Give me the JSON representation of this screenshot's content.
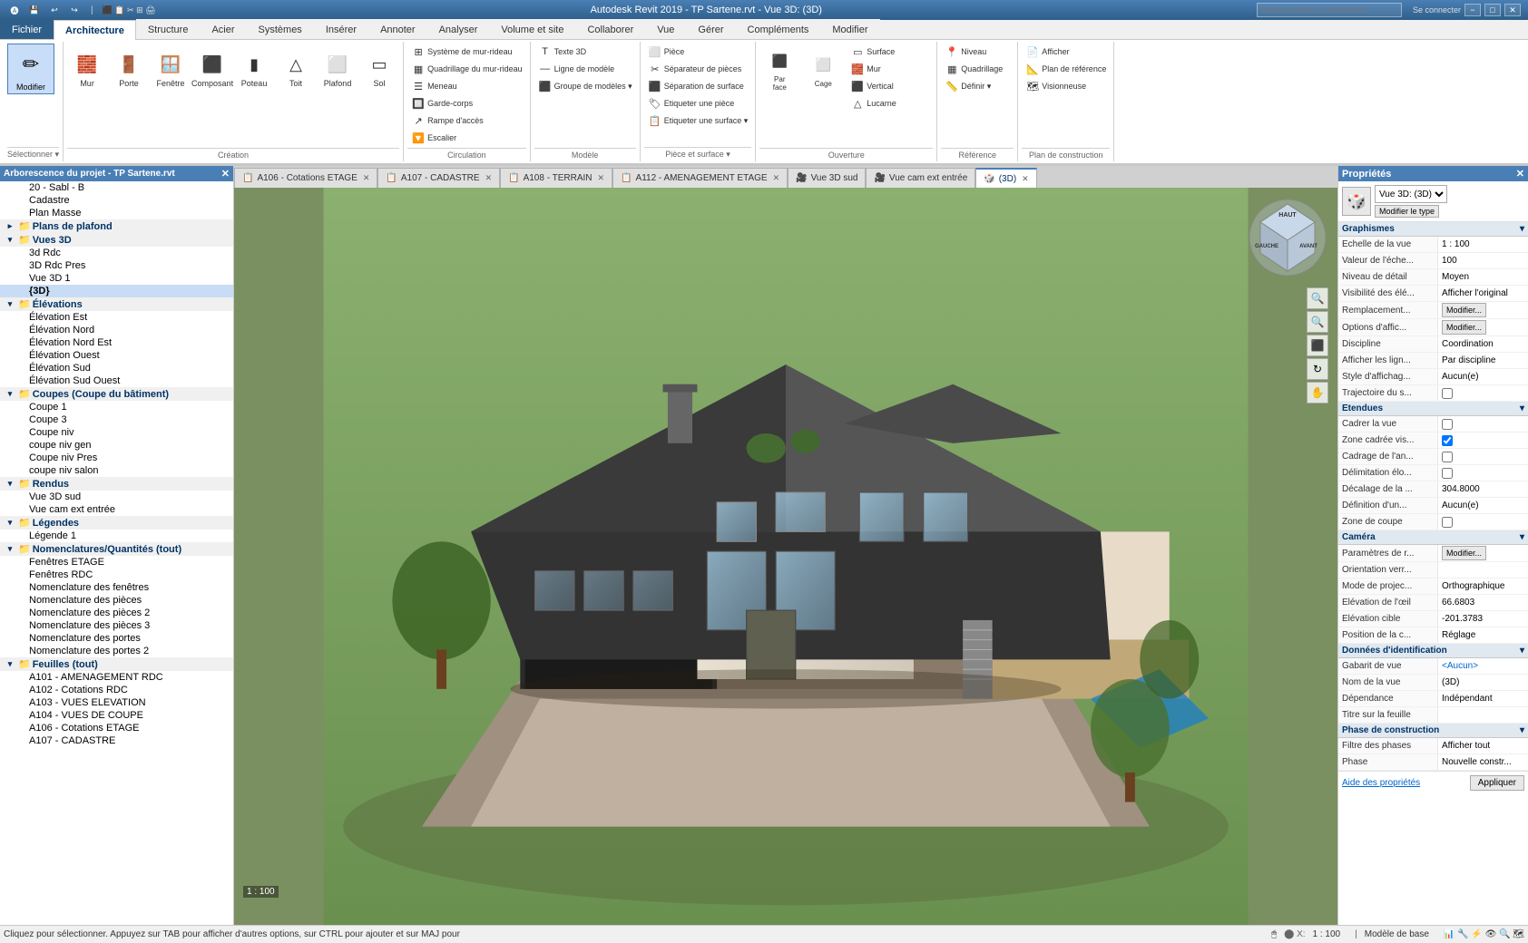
{
  "titlebar": {
    "title": "Autodesk Revit 2019 - TP Sartene.rvt - Vue 3D: (3D)",
    "search_placeholder": "Entrez mot-clé ou expression",
    "connect_label": "Se connecter",
    "window_controls": [
      "−",
      "□",
      "✕"
    ]
  },
  "quickaccess": {
    "buttons": [
      "🗁",
      "💾",
      "↩",
      "↪",
      "⬛",
      "📋",
      "✂",
      "📎",
      "🖨",
      "❓"
    ]
  },
  "ribbon": {
    "active_tab": "Architecture",
    "tabs": [
      "Fichier",
      "Architecture",
      "Structure",
      "Acier",
      "Systèmes",
      "Insérer",
      "Annoter",
      "Analyser",
      "Volume et site",
      "Collaborer",
      "Vue",
      "Gérer",
      "Compléments",
      "Modifier"
    ],
    "groups": [
      {
        "label": "Sélectionner",
        "items": [
          {
            "type": "large",
            "icon": "✏",
            "label": "Modifier",
            "active": true
          }
        ]
      },
      {
        "label": "Création",
        "items": [
          {
            "type": "large",
            "icon": "🧱",
            "label": "Mur"
          },
          {
            "type": "large",
            "icon": "🚪",
            "label": "Porte"
          },
          {
            "type": "large",
            "icon": "🪟",
            "label": "Fenêtre"
          },
          {
            "type": "large",
            "icon": "⬛",
            "label": "Composant"
          },
          {
            "type": "large",
            "icon": "▮",
            "label": "Poteau"
          },
          {
            "type": "large",
            "icon": "△",
            "label": "Toit"
          },
          {
            "type": "large",
            "icon": "⬜",
            "label": "Plafond"
          },
          {
            "type": "large",
            "icon": "▭",
            "label": "Sol"
          }
        ]
      },
      {
        "label": "Circulation",
        "items": [
          {
            "type": "small",
            "icon": "⬛",
            "label": "Système de mur-rideau"
          },
          {
            "type": "small",
            "icon": "▦",
            "label": "Quadrillage du mur-rideau"
          },
          {
            "type": "small",
            "icon": "☰",
            "label": "Meneau"
          },
          {
            "type": "small",
            "icon": "🔲",
            "label": "Garde-corps"
          },
          {
            "type": "small",
            "icon": "↗",
            "label": "Rampe d'accès"
          },
          {
            "type": "small",
            "icon": "🔽",
            "label": "Escalier"
          }
        ]
      },
      {
        "label": "Modèle",
        "items": [
          {
            "type": "small",
            "icon": "T",
            "label": "Texte 3D"
          },
          {
            "type": "small",
            "icon": "—",
            "label": "Ligne de modèle"
          },
          {
            "type": "small",
            "icon": "⬛",
            "label": "Groupe de modèles"
          }
        ]
      },
      {
        "label": "Pièce et surface",
        "items": [
          {
            "type": "small",
            "icon": "⬜",
            "label": "Pièce"
          },
          {
            "type": "small",
            "icon": "✂",
            "label": "Séparateur de pièces"
          },
          {
            "type": "small",
            "icon": "⬛",
            "label": "Séparation de surface"
          },
          {
            "type": "small",
            "icon": "🏷",
            "label": "Etiqueter une pièce"
          },
          {
            "type": "small",
            "icon": "📋",
            "label": "Etiqueter une surface"
          }
        ]
      },
      {
        "label": "Ouverture",
        "items": [
          {
            "type": "small",
            "icon": "▭",
            "label": "Surface"
          },
          {
            "type": "small",
            "icon": "🧱",
            "label": "Mur"
          },
          {
            "type": "small",
            "icon": "⬛",
            "label": "Vertical"
          },
          {
            "type": "large",
            "icon": "🔲",
            "label": "Par face"
          },
          {
            "type": "large",
            "icon": "⬛",
            "label": "Cage"
          },
          {
            "type": "small",
            "icon": "↗",
            "label": "Lucarne"
          }
        ]
      },
      {
        "label": "Référence",
        "items": [
          {
            "type": "small",
            "icon": "📍",
            "label": "Niveau"
          },
          {
            "type": "small",
            "icon": "📐",
            "label": "Quadrillage"
          },
          {
            "type": "small",
            "icon": "📏",
            "label": "Définir"
          }
        ]
      },
      {
        "label": "Plan de construction",
        "items": [
          {
            "type": "small",
            "icon": "📄",
            "label": "Afficher"
          },
          {
            "type": "small",
            "icon": "📐",
            "label": "Plan de référence"
          },
          {
            "type": "small",
            "icon": "🗺",
            "label": "Visionneuse"
          }
        ]
      }
    ]
  },
  "sidebar": {
    "title": "Arborescence du projet - TP Sartene.rvt",
    "tree": [
      {
        "level": 1,
        "text": "20 - Sabl - B",
        "type": "item"
      },
      {
        "level": 1,
        "text": "Cadastre",
        "type": "item"
      },
      {
        "level": 1,
        "text": "Plan Masse",
        "type": "item",
        "selected": false
      },
      {
        "level": 0,
        "text": "Plans de plafond",
        "type": "group",
        "expanded": false
      },
      {
        "level": 0,
        "text": "Vues 3D",
        "type": "group",
        "expanded": true
      },
      {
        "level": 1,
        "text": "3d Rdc",
        "type": "item"
      },
      {
        "level": 1,
        "text": "3D Rdc Pres",
        "type": "item"
      },
      {
        "level": 1,
        "text": "Vue 3D 1",
        "type": "item"
      },
      {
        "level": 1,
        "text": "{3D}",
        "type": "item",
        "selected": true,
        "bold": true
      },
      {
        "level": 0,
        "text": "Élévations",
        "type": "group",
        "expanded": true
      },
      {
        "level": 1,
        "text": "Élévation Est",
        "type": "item"
      },
      {
        "level": 1,
        "text": "Élévation Nord",
        "type": "item"
      },
      {
        "level": 1,
        "text": "Élévation Nord Est",
        "type": "item"
      },
      {
        "level": 1,
        "text": "Élévation Ouest",
        "type": "item"
      },
      {
        "level": 1,
        "text": "Élévation Sud",
        "type": "item"
      },
      {
        "level": 1,
        "text": "Élévation Sud Ouest",
        "type": "item"
      },
      {
        "level": 0,
        "text": "Coupes (Coupe du bâtiment)",
        "type": "group",
        "expanded": true
      },
      {
        "level": 1,
        "text": "Coupe 1",
        "type": "item"
      },
      {
        "level": 1,
        "text": "Coupe 3",
        "type": "item"
      },
      {
        "level": 1,
        "text": "Coupe niv",
        "type": "item"
      },
      {
        "level": 1,
        "text": "coupe niv gen",
        "type": "item"
      },
      {
        "level": 1,
        "text": "Coupe niv Pres",
        "type": "item"
      },
      {
        "level": 1,
        "text": "coupe niv salon",
        "type": "item"
      },
      {
        "level": 0,
        "text": "Rendus",
        "type": "group",
        "expanded": true
      },
      {
        "level": 1,
        "text": "Vue 3D sud",
        "type": "item"
      },
      {
        "level": 1,
        "text": "Vue cam ext entrée",
        "type": "item"
      },
      {
        "level": 0,
        "text": "Légendes",
        "type": "group",
        "expanded": true
      },
      {
        "level": 1,
        "text": "Légende 1",
        "type": "item"
      },
      {
        "level": 0,
        "text": "Nomenclatures/Quantités (tout)",
        "type": "group",
        "expanded": true
      },
      {
        "level": 1,
        "text": "Fenêtres ETAGE",
        "type": "item"
      },
      {
        "level": 1,
        "text": "Fenêtres RDC",
        "type": "item"
      },
      {
        "level": 1,
        "text": "Nomenclature des fenêtres",
        "type": "item"
      },
      {
        "level": 1,
        "text": "Nomenclature des pièces",
        "type": "item"
      },
      {
        "level": 1,
        "text": "Nomenclature des pièces 2",
        "type": "item"
      },
      {
        "level": 1,
        "text": "Nomenclature des pièces 3",
        "type": "item"
      },
      {
        "level": 1,
        "text": "Nomenclature des portes",
        "type": "item"
      },
      {
        "level": 1,
        "text": "Nomenclature des portes 2",
        "type": "item"
      },
      {
        "level": 0,
        "text": "Feuilles (tout)",
        "type": "group",
        "expanded": true
      },
      {
        "level": 1,
        "text": "A101 - AMENAGEMENT RDC",
        "type": "item"
      },
      {
        "level": 1,
        "text": "A102 - Cotations RDC",
        "type": "item"
      },
      {
        "level": 1,
        "text": "A103 - VUES ELEVATION",
        "type": "item"
      },
      {
        "level": 1,
        "text": "A104 - VUES DE COUPE",
        "type": "item"
      },
      {
        "level": 1,
        "text": "A106 - Cotations ETAGE",
        "type": "item"
      },
      {
        "level": 1,
        "text": "A107 - CADASTRE",
        "type": "item"
      }
    ]
  },
  "viewport": {
    "tabs": [
      {
        "label": "A106 - Cotations ETAGE",
        "icon": "📋",
        "closable": true
      },
      {
        "label": "A107 - CADASTRE",
        "icon": "📋",
        "closable": true
      },
      {
        "label": "A108 - TERRAIN",
        "icon": "📋",
        "closable": true
      },
      {
        "label": "A112 - AMENAGEMENT ETAGE",
        "icon": "📋",
        "closable": true
      },
      {
        "label": "Vue 3D sud",
        "icon": "🎥",
        "closable": false
      },
      {
        "label": "Vue cam ext entrée",
        "icon": "🎥",
        "closable": false
      },
      {
        "label": "(3D)",
        "icon": "🎲",
        "closable": true,
        "active": true
      }
    ],
    "scale": "1 : 100",
    "nav_cube": {
      "labels": [
        "GAUCHE",
        "AVANT"
      ]
    }
  },
  "properties": {
    "title": "Propriétés",
    "view_type": "Vue 3D",
    "view_selector": "Vue 3D: (3D)",
    "modify_btn": "Modifier le type",
    "sections": [
      {
        "name": "Graphismes",
        "rows": [
          {
            "label": "Echelle de la vue",
            "value": "1 : 100"
          },
          {
            "label": "Valeur de l'éche...",
            "value": "100"
          },
          {
            "label": "Niveau de détail",
            "value": "Moyen"
          },
          {
            "label": "Visibilité des élé...",
            "value": "Afficher l'original"
          },
          {
            "label": "Remplacement...",
            "value": "",
            "btn": "Modifier..."
          },
          {
            "label": "Options d'affic...",
            "value": "",
            "btn": "Modifier..."
          },
          {
            "label": "Discipline",
            "value": "Coordination"
          },
          {
            "label": "Afficher les lign...",
            "value": "Par discipline"
          },
          {
            "label": "Style d'affichag...",
            "value": "Aucun(e)"
          },
          {
            "label": "Trajectoire du s...",
            "value": "",
            "check": false
          }
        ]
      },
      {
        "name": "Etendues",
        "rows": [
          {
            "label": "Cadrer la vue",
            "value": "",
            "check": false
          },
          {
            "label": "Zone cadrée vis...",
            "value": "",
            "check": true
          },
          {
            "label": "Cadrage de l'an...",
            "value": "",
            "check": false
          },
          {
            "label": "Délimitation élo...",
            "value": "",
            "check": false
          },
          {
            "label": "Décalage de la ...",
            "value": "304.8000"
          },
          {
            "label": "Définition d'un...",
            "value": "Aucun(e)"
          },
          {
            "label": "Zone de coupe",
            "value": "",
            "check": false
          }
        ]
      },
      {
        "name": "Caméra",
        "rows": [
          {
            "label": "Paramètres de r...",
            "value": "",
            "btn": "Modifier..."
          },
          {
            "label": "Orientation verr...",
            "value": ""
          },
          {
            "label": "Mode de projec...",
            "value": "Orthographique"
          },
          {
            "label": "Elévation de l'œil",
            "value": "66.6803"
          },
          {
            "label": "Elévation cible",
            "value": "-201.3783"
          },
          {
            "label": "Position de la c...",
            "value": "Réglage"
          }
        ]
      },
      {
        "name": "Données d'identification",
        "rows": [
          {
            "label": "Gabarit de vue",
            "value": "<Aucun>"
          },
          {
            "label": "Nom de la vue",
            "value": "(3D)"
          },
          {
            "label": "Dépendance",
            "value": "Indépendant"
          },
          {
            "label": "Titre sur la feuille",
            "value": ""
          }
        ]
      },
      {
        "name": "Phase de construction",
        "rows": [
          {
            "label": "Filtre des phases",
            "value": "Afficher tout"
          },
          {
            "label": "Phase",
            "value": "Nouvelle constr..."
          }
        ]
      }
    ],
    "help_link": "Aide des propriétés",
    "apply_btn": "Appliquer"
  },
  "statusbar": {
    "message": "Cliquez pour sélectionner. Appuyez sur TAB pour afficher d'autres options, sur CTRL pour ajouter et sur MAJ pour",
    "scale": "1 : 100",
    "model": "Modèle de base",
    "icons": [
      "📊",
      "🔧",
      "⚡",
      "👁",
      "🔍"
    ]
  }
}
